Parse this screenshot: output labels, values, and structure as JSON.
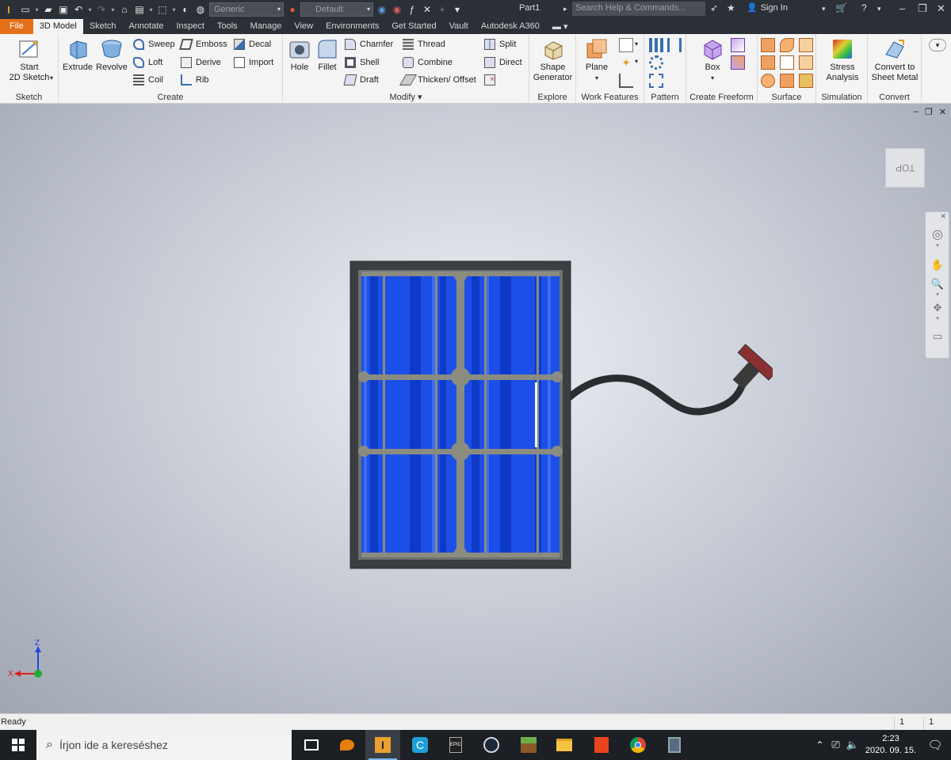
{
  "titlebar": {
    "visual_style": "Generic",
    "appearance": "Default",
    "doc_name": "Part1",
    "search_placeholder": "Search Help & Commands...",
    "sign_in": "Sign In"
  },
  "menu": {
    "tabs": [
      "File",
      "3D Model",
      "Sketch",
      "Annotate",
      "Inspect",
      "Tools",
      "Manage",
      "View",
      "Environments",
      "Get Started",
      "Vault",
      "Autodesk A360"
    ],
    "active": "3D Model"
  },
  "ribbon": {
    "sketch": {
      "title": "Sketch",
      "start1": "Start",
      "start2": "2D Sketch"
    },
    "create": {
      "title": "Create",
      "extrude": "Extrude",
      "revolve": "Revolve",
      "sweep": "Sweep",
      "loft": "Loft",
      "coil": "Coil",
      "emboss": "Emboss",
      "derive": "Derive",
      "rib": "Rib",
      "decal": "Decal",
      "import": "Import"
    },
    "modify": {
      "title": "Modify",
      "hole": "Hole",
      "fillet": "Fillet",
      "chamfer": "Chamfer",
      "shell": "Shell",
      "draft": "Draft",
      "thread": "Thread",
      "combine": "Combine",
      "thicken": "Thicken/ Offset",
      "split": "Split",
      "direct": "Direct"
    },
    "explore": {
      "title": "Explore",
      "shape1": "Shape",
      "shape2": "Generator"
    },
    "work": {
      "title": "Work Features",
      "plane": "Plane"
    },
    "pattern": {
      "title": "Pattern"
    },
    "freeform": {
      "title": "Create Freeform",
      "box": "Box"
    },
    "surface": {
      "title": "Surface"
    },
    "simulation": {
      "title": "Simulation",
      "stress1": "Stress",
      "stress2": "Analysis"
    },
    "convert": {
      "title": "Convert",
      "conv1": "Convert to",
      "conv2": "Sheet Metal"
    }
  },
  "viewport": {
    "viewcube_label": "TOP",
    "triad_x": "X",
    "triad_z": "Z"
  },
  "statusbar": {
    "status": "Ready",
    "count1": "1",
    "count2": "1"
  },
  "taskbar": {
    "search_placeholder": "Írjon ide a kereséshez",
    "time": "2:23",
    "date": "2020. 09. 15."
  }
}
